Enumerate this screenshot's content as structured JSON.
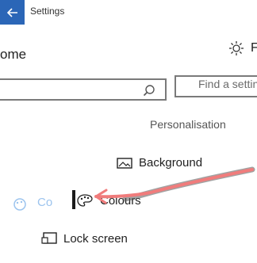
{
  "window": {
    "title": "Settings"
  },
  "ghost": {
    "home_label": "ome",
    "right_label": "F",
    "colours_label": "Co"
  },
  "search": {
    "placeholder": "Find a settin"
  },
  "section": {
    "title": "Personalisation"
  },
  "nav": {
    "items": [
      {
        "label": "Background",
        "icon": "picture-icon"
      },
      {
        "label": "Colours",
        "icon": "palette-icon"
      },
      {
        "label": "Lock screen",
        "icon": "lock-screen-icon"
      }
    ]
  },
  "colors": {
    "accent": "#2b66b7",
    "annotation_arrow": "#f07c7c"
  }
}
